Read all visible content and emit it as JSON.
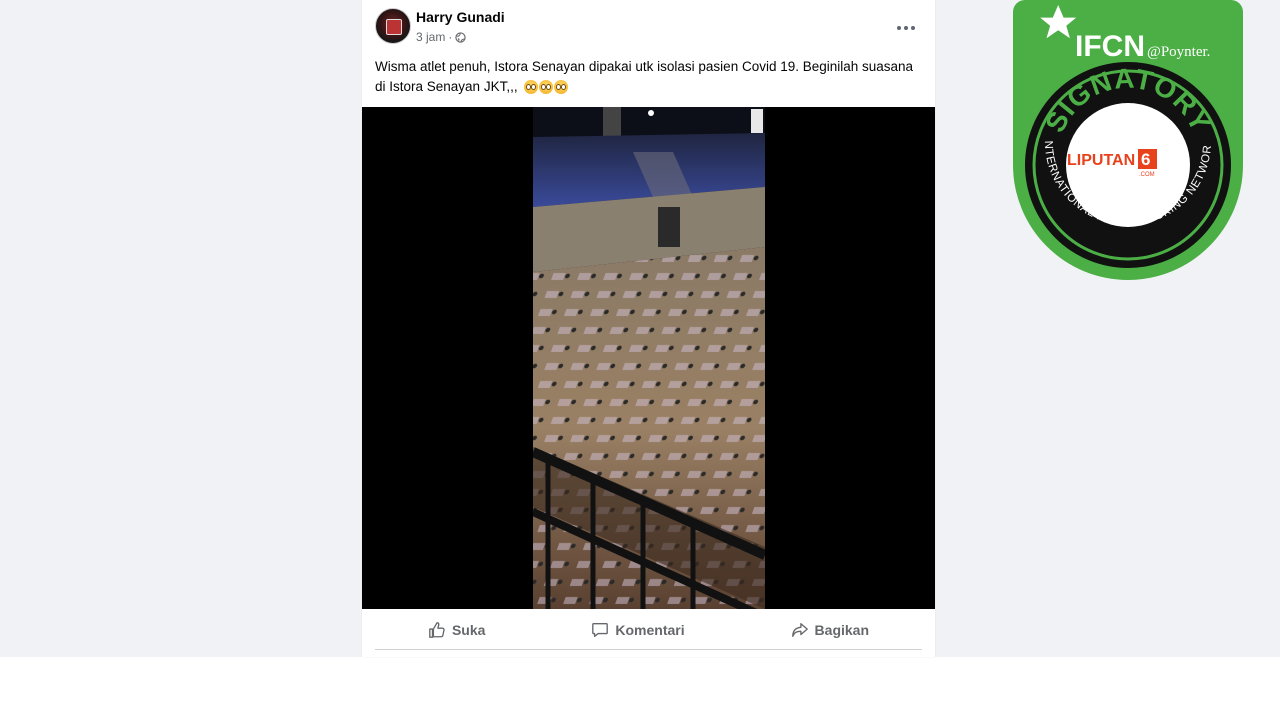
{
  "post": {
    "author": "Harry Gunadi",
    "timestamp": "3 jam",
    "separator": "·",
    "text": "Wisma atlet penuh, Istora Senayan dipakai utk isolasi pasien Covid 19. Beginilah suasana di Istora Senayan JKT,,,",
    "emoji_count": 3,
    "icons": {
      "privacy": "globe-icon",
      "menu": "more-options-icon"
    }
  },
  "actions": [
    {
      "label": "Suka",
      "icon": "thumbs-up-icon"
    },
    {
      "label": "Komentari",
      "icon": "comment-icon"
    },
    {
      "label": "Bagikan",
      "icon": "share-icon"
    }
  ],
  "badge": {
    "org": "IFCN",
    "partner": "@Poynter.",
    "status": "SIGNATORY",
    "network": "INTERNATIONAL FACT-CHECKING NETWORK",
    "member_logo": "LIPUTAN",
    "member_logo_digit": "6",
    "member_logo_suffix": ".COM",
    "colors": {
      "green": "#4caf46",
      "dark": "#111111",
      "brand_red": "#e8421d"
    }
  }
}
